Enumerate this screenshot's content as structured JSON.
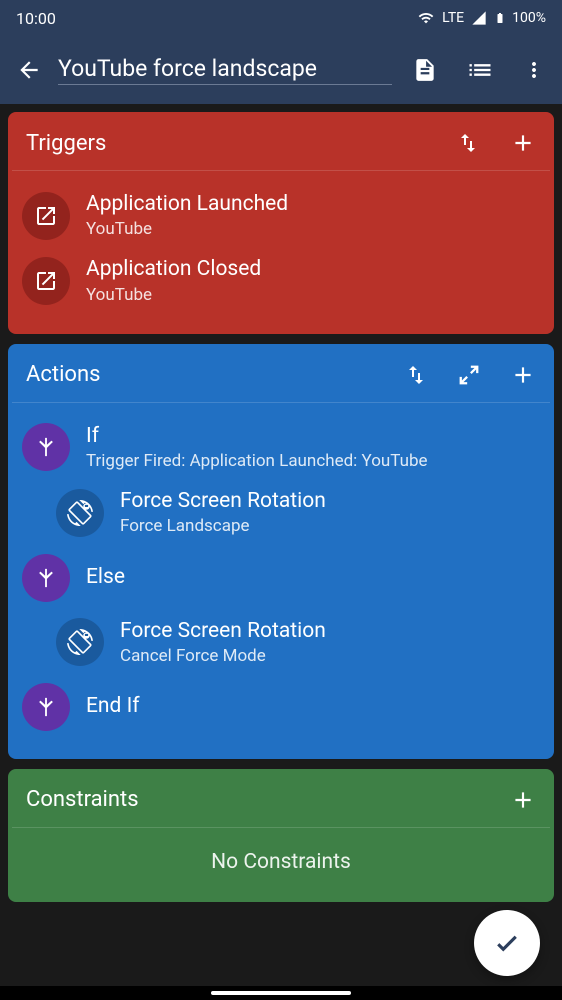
{
  "status_bar": {
    "time": "10:00",
    "network": "LTE",
    "battery": "100%"
  },
  "app_bar": {
    "title": "YouTube force landscape"
  },
  "triggers": {
    "title": "Triggers",
    "items": [
      {
        "title": "Application Launched",
        "subtitle": "YouTube"
      },
      {
        "title": "Application Closed",
        "subtitle": "YouTube"
      }
    ]
  },
  "actions": {
    "title": "Actions",
    "items": [
      {
        "title": "If",
        "subtitle": "Trigger Fired: Application Launched: YouTube",
        "icon": "branch",
        "indent": false
      },
      {
        "title": "Force Screen Rotation",
        "subtitle": "Force Landscape",
        "icon": "rotation",
        "indent": true
      },
      {
        "title": "Else",
        "subtitle": "",
        "icon": "branch",
        "indent": false
      },
      {
        "title": "Force Screen Rotation",
        "subtitle": "Cancel Force Mode",
        "icon": "rotation",
        "indent": true
      },
      {
        "title": "End If",
        "subtitle": "",
        "icon": "branch",
        "indent": false
      }
    ]
  },
  "constraints": {
    "title": "Constraints",
    "empty_text": "No Constraints"
  }
}
